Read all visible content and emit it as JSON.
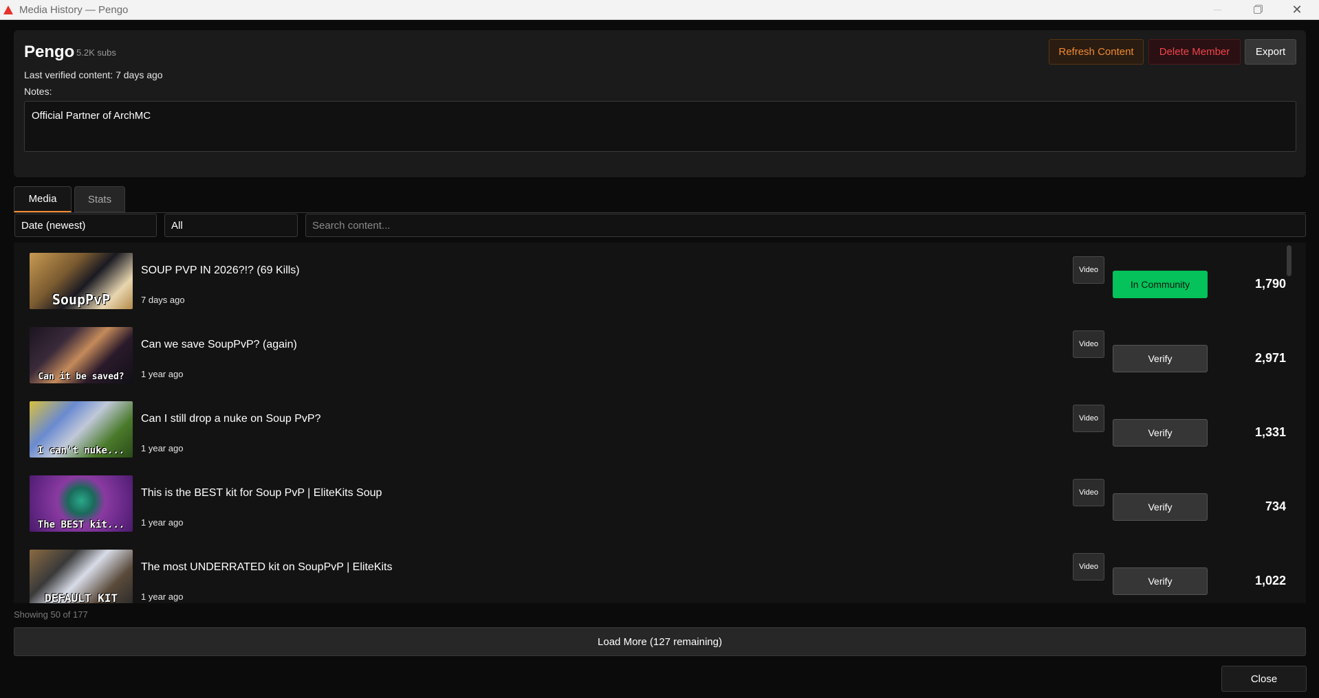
{
  "window": {
    "title": "Media History — Pengo"
  },
  "channel": {
    "name": "Pengo",
    "subs": "5.2K subs",
    "last_verified": "Last verified content: 7 days ago",
    "notes_label": "Notes:",
    "notes_text": "Official Partner of ArchMC"
  },
  "actions": {
    "refresh": "Refresh Content",
    "delete": "Delete Member",
    "export": "Export"
  },
  "tabs": [
    {
      "label": "Media",
      "active": true
    },
    {
      "label": "Stats",
      "active": false
    }
  ],
  "filters": {
    "sort": "Date (newest)",
    "type": "All",
    "search_placeholder": "Search content..."
  },
  "items": [
    {
      "title": "SOUP PVP IN 2026?!? (69 Kills)",
      "date": "7 days ago",
      "type": "Video",
      "action": "In Community",
      "views": "1,790",
      "thumb_caption": "SoupPvP"
    },
    {
      "title": "Can we save SoupPvP? (again)",
      "date": "1 year ago",
      "type": "Video",
      "action": "Verify",
      "views": "2,971",
      "thumb_caption": "Can it be saved?"
    },
    {
      "title": "Can I still drop a nuke on Soup PvP?",
      "date": "1 year ago",
      "type": "Video",
      "action": "Verify",
      "views": "1,331",
      "thumb_caption": "I can't nuke..."
    },
    {
      "title": "This is the BEST kit for Soup PvP | EliteKits Soup",
      "date": "1 year ago",
      "type": "Video",
      "action": "Verify",
      "views": "734",
      "thumb_caption": "The BEST kit..."
    },
    {
      "title": "The most UNDERRATED kit on SoupPvP | EliteKits",
      "date": "1 year ago",
      "type": "Video",
      "action": "Verify",
      "views": "1,022",
      "thumb_caption": "DEFAULT KIT"
    }
  ],
  "footer": {
    "showing": "Showing 50 of 177",
    "load_more": "Load More (127 remaining)",
    "close": "Close"
  },
  "colors": {
    "accent_orange": "#f28a2e",
    "danger_red": "#f0444c",
    "community_green": "#05c25a"
  }
}
